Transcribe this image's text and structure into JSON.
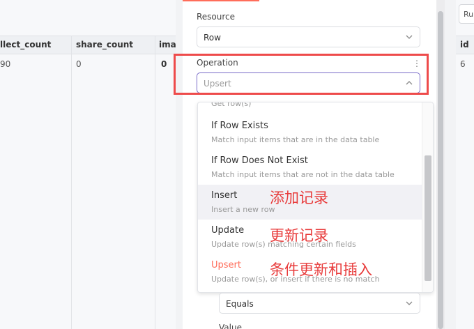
{
  "table": {
    "columns": [
      {
        "header": "llect_count",
        "value": "90"
      },
      {
        "header": "share_count",
        "value": "0"
      },
      {
        "header": "ima",
        "value": "0"
      }
    ],
    "right_column": {
      "header": "id",
      "value": "6"
    },
    "run_button_label": "Ru"
  },
  "panel": {
    "resource_label": "Resource",
    "resource_value": "Row",
    "operation_label": "Operation",
    "operation_value": "Upsert",
    "dropdown": {
      "cut_item": "Get row(s)",
      "items": [
        {
          "title": "If Row Exists",
          "desc": "Match input items that are in the data table",
          "note": ""
        },
        {
          "title": "If Row Does Not Exist",
          "desc": "Match input items that are not in the data table",
          "note": ""
        },
        {
          "title": "Insert",
          "desc": "Insert a new row",
          "note": "添加记录"
        },
        {
          "title": "Update",
          "desc": "Update row(s) matching certain fields",
          "note": "更新记录"
        },
        {
          "title": "Upsert",
          "desc": "Update row(s), or insert if there is no match",
          "note": "条件更新和插入"
        }
      ]
    },
    "condition_value": "Equals",
    "value_label": "Value"
  },
  "colors": {
    "accent": "#ff6d5a",
    "annotation": "#e83b3b",
    "focus": "#7a6cc8"
  }
}
